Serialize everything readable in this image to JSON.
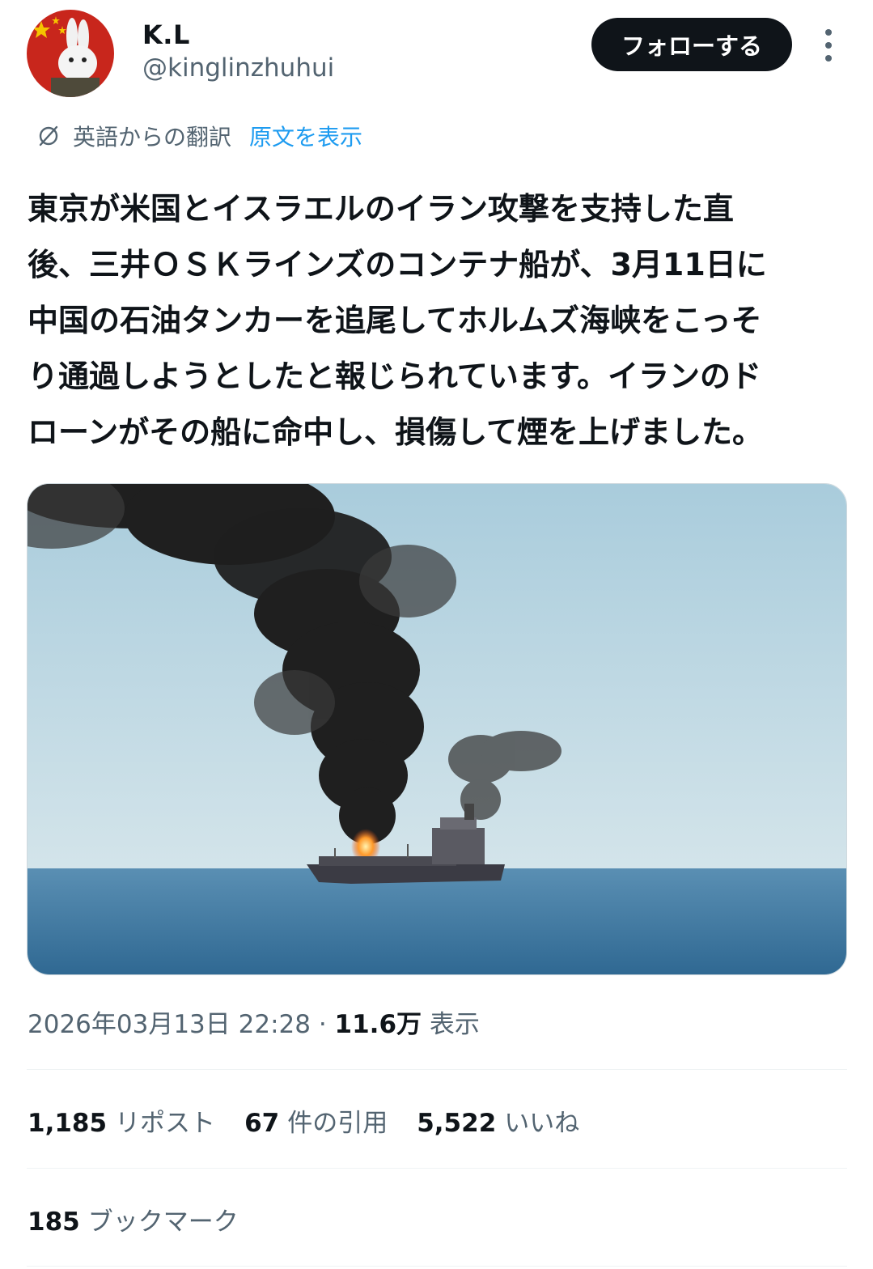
{
  "user": {
    "name": "K.L",
    "handle": "@kinglinzhuhui",
    "follow_label": "フォローする"
  },
  "translation": {
    "label": "英語からの翻訳",
    "show_original": "原文を表示"
  },
  "tweet": {
    "lines": [
      "東京が米国とイスラエルのイラン攻撃を支持した直",
      "後、三井ＯＳＫラインズのコンテナ船が、3月11日に",
      "中国の石油タンカーを追尾してホルムズ海峡をこっそ",
      "り通過しようとしたと報じられています。イランのド",
      "ローンがその船に命中し、損傷して煙を上げました。"
    ]
  },
  "meta": {
    "timestamp": "2026年03月13日 22:28",
    "separator": " · ",
    "views_count": "11.6万",
    "views_label": "表示"
  },
  "stats": {
    "reposts_count": "1,185",
    "reposts_label": "リポスト",
    "quotes_count": "67",
    "quotes_label": "件の引用",
    "likes_count": "5,522",
    "likes_label": "いいね",
    "bookmarks_count": "185",
    "bookmarks_label": "ブックマーク"
  },
  "colors": {
    "text": "#0f1419",
    "secondary": "#536471",
    "link": "#1d9bf0",
    "follow_button": "#0f1419",
    "divider": "#eff3f4"
  }
}
